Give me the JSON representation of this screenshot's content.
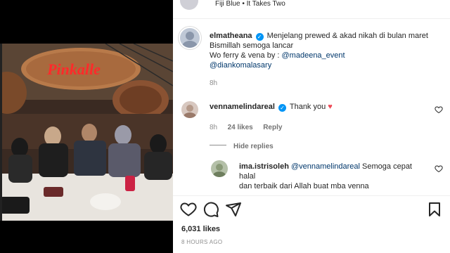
{
  "top_bar": {
    "song": "Fiji Blue • It Takes Two"
  },
  "photo": {
    "sign_text": "Pinkalle"
  },
  "caption": {
    "username": "elmatheana",
    "lines": [
      "Menjelang prewed & akad nikah di bulan maret",
      "Bismillah semoga lancar",
      "Wo ferry & vena by : "
    ],
    "mention_1": "@madeena_event",
    "mention_2": "@dianko​malasary",
    "time": "8h"
  },
  "comments": [
    {
      "username": "vennamelindareal",
      "text": "Thank you",
      "emoji": "❤️",
      "time": "8h",
      "likes": "24 likes",
      "reply": "Reply"
    }
  ],
  "hide_replies": "Hide replies",
  "reply_comment": {
    "username": "ima.istrisoleh",
    "mention": "@vennamelindareal",
    "text_1": " Semoga cepat halal",
    "text_2": "dan terbaik dari Allah buat mba venna"
  },
  "actions": {
    "likes": "6,031 likes",
    "time_ago": "8 HOURS AGO"
  },
  "colors": {
    "verified": "#0095f6",
    "heart": "#ed4956",
    "sign": "#ff2a2a"
  }
}
